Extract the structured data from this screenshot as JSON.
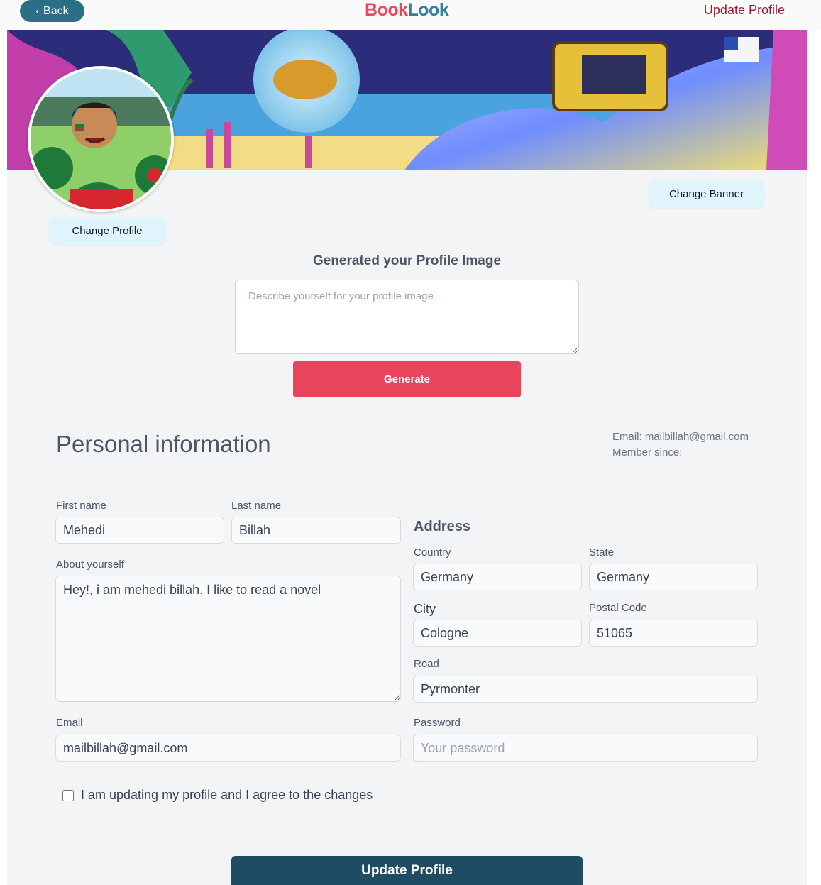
{
  "topbar": {
    "back_label": "Back",
    "logo_part1": "Book",
    "logo_part2": "Look",
    "update_profile_link": "Update Profile"
  },
  "profile": {
    "change_banner_label": "Change Banner",
    "change_profile_label": "Change Profile"
  },
  "generator": {
    "title": "Generated your Profile Image",
    "placeholder": "Describe yourself for your profile image",
    "generate_label": "Generate"
  },
  "personal": {
    "title": "Personal information",
    "email_meta": "Email: mailbillah@gmail.com",
    "member_since": "Member since:",
    "first_name_label": "First name",
    "first_name": "Mehedi",
    "last_name_label": "Last name",
    "last_name": "Billah",
    "about_label": "About yourself",
    "about": "Hey!, i am mehedi billah. I like to read a novel",
    "email_label": "Email",
    "email": "mailbillah@gmail.com"
  },
  "address": {
    "title": "Address",
    "country_label": "Country",
    "country": "Germany",
    "state_label": "State",
    "state": "Germany",
    "city_label": "City",
    "city": "Cologne",
    "postal_label": "Postal Code",
    "postal": "51065",
    "road_label": "Road",
    "road": "Pyrmonter",
    "password_label": "Password",
    "password_placeholder": "Your password"
  },
  "agree_text": "I am updating my profile and I agree to the changes",
  "submit_label": "Update Profile",
  "colors": {
    "accent_red": "#e8455d",
    "dark_teal": "#1f4b63",
    "back_button": "#2a6f86",
    "pill_bg": "#dff5fb",
    "link_red": "#9b1c2e"
  }
}
